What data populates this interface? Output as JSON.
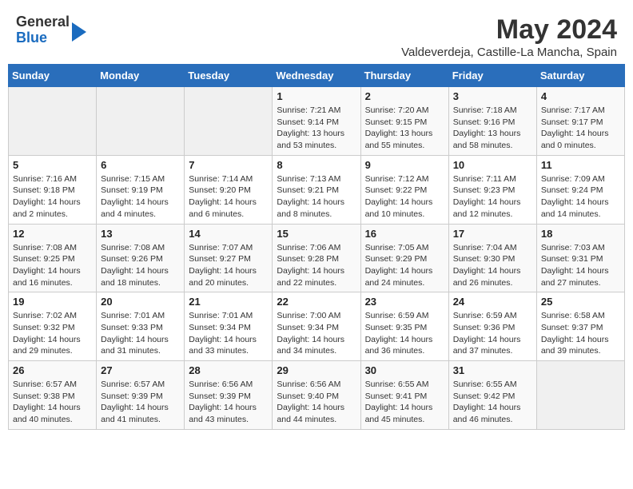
{
  "header": {
    "logo": {
      "line1": "General",
      "line2": "Blue"
    },
    "title": "May 2024",
    "location": "Valdeverdeja, Castille-La Mancha, Spain"
  },
  "days_of_week": [
    "Sunday",
    "Monday",
    "Tuesday",
    "Wednesday",
    "Thursday",
    "Friday",
    "Saturday"
  ],
  "weeks": [
    [
      {
        "day": "",
        "text": ""
      },
      {
        "day": "",
        "text": ""
      },
      {
        "day": "",
        "text": ""
      },
      {
        "day": "1",
        "text": "Sunrise: 7:21 AM\nSunset: 9:14 PM\nDaylight: 13 hours and 53 minutes."
      },
      {
        "day": "2",
        "text": "Sunrise: 7:20 AM\nSunset: 9:15 PM\nDaylight: 13 hours and 55 minutes."
      },
      {
        "day": "3",
        "text": "Sunrise: 7:18 AM\nSunset: 9:16 PM\nDaylight: 13 hours and 58 minutes."
      },
      {
        "day": "4",
        "text": "Sunrise: 7:17 AM\nSunset: 9:17 PM\nDaylight: 14 hours and 0 minutes."
      }
    ],
    [
      {
        "day": "5",
        "text": "Sunrise: 7:16 AM\nSunset: 9:18 PM\nDaylight: 14 hours and 2 minutes."
      },
      {
        "day": "6",
        "text": "Sunrise: 7:15 AM\nSunset: 9:19 PM\nDaylight: 14 hours and 4 minutes."
      },
      {
        "day": "7",
        "text": "Sunrise: 7:14 AM\nSunset: 9:20 PM\nDaylight: 14 hours and 6 minutes."
      },
      {
        "day": "8",
        "text": "Sunrise: 7:13 AM\nSunset: 9:21 PM\nDaylight: 14 hours and 8 minutes."
      },
      {
        "day": "9",
        "text": "Sunrise: 7:12 AM\nSunset: 9:22 PM\nDaylight: 14 hours and 10 minutes."
      },
      {
        "day": "10",
        "text": "Sunrise: 7:11 AM\nSunset: 9:23 PM\nDaylight: 14 hours and 12 minutes."
      },
      {
        "day": "11",
        "text": "Sunrise: 7:09 AM\nSunset: 9:24 PM\nDaylight: 14 hours and 14 minutes."
      }
    ],
    [
      {
        "day": "12",
        "text": "Sunrise: 7:08 AM\nSunset: 9:25 PM\nDaylight: 14 hours and 16 minutes."
      },
      {
        "day": "13",
        "text": "Sunrise: 7:08 AM\nSunset: 9:26 PM\nDaylight: 14 hours and 18 minutes."
      },
      {
        "day": "14",
        "text": "Sunrise: 7:07 AM\nSunset: 9:27 PM\nDaylight: 14 hours and 20 minutes."
      },
      {
        "day": "15",
        "text": "Sunrise: 7:06 AM\nSunset: 9:28 PM\nDaylight: 14 hours and 22 minutes."
      },
      {
        "day": "16",
        "text": "Sunrise: 7:05 AM\nSunset: 9:29 PM\nDaylight: 14 hours and 24 minutes."
      },
      {
        "day": "17",
        "text": "Sunrise: 7:04 AM\nSunset: 9:30 PM\nDaylight: 14 hours and 26 minutes."
      },
      {
        "day": "18",
        "text": "Sunrise: 7:03 AM\nSunset: 9:31 PM\nDaylight: 14 hours and 27 minutes."
      }
    ],
    [
      {
        "day": "19",
        "text": "Sunrise: 7:02 AM\nSunset: 9:32 PM\nDaylight: 14 hours and 29 minutes."
      },
      {
        "day": "20",
        "text": "Sunrise: 7:01 AM\nSunset: 9:33 PM\nDaylight: 14 hours and 31 minutes."
      },
      {
        "day": "21",
        "text": "Sunrise: 7:01 AM\nSunset: 9:34 PM\nDaylight: 14 hours and 33 minutes."
      },
      {
        "day": "22",
        "text": "Sunrise: 7:00 AM\nSunset: 9:34 PM\nDaylight: 14 hours and 34 minutes."
      },
      {
        "day": "23",
        "text": "Sunrise: 6:59 AM\nSunset: 9:35 PM\nDaylight: 14 hours and 36 minutes."
      },
      {
        "day": "24",
        "text": "Sunrise: 6:59 AM\nSunset: 9:36 PM\nDaylight: 14 hours and 37 minutes."
      },
      {
        "day": "25",
        "text": "Sunrise: 6:58 AM\nSunset: 9:37 PM\nDaylight: 14 hours and 39 minutes."
      }
    ],
    [
      {
        "day": "26",
        "text": "Sunrise: 6:57 AM\nSunset: 9:38 PM\nDaylight: 14 hours and 40 minutes."
      },
      {
        "day": "27",
        "text": "Sunrise: 6:57 AM\nSunset: 9:39 PM\nDaylight: 14 hours and 41 minutes."
      },
      {
        "day": "28",
        "text": "Sunrise: 6:56 AM\nSunset: 9:39 PM\nDaylight: 14 hours and 43 minutes."
      },
      {
        "day": "29",
        "text": "Sunrise: 6:56 AM\nSunset: 9:40 PM\nDaylight: 14 hours and 44 minutes."
      },
      {
        "day": "30",
        "text": "Sunrise: 6:55 AM\nSunset: 9:41 PM\nDaylight: 14 hours and 45 minutes."
      },
      {
        "day": "31",
        "text": "Sunrise: 6:55 AM\nSunset: 9:42 PM\nDaylight: 14 hours and 46 minutes."
      },
      {
        "day": "",
        "text": ""
      }
    ]
  ]
}
